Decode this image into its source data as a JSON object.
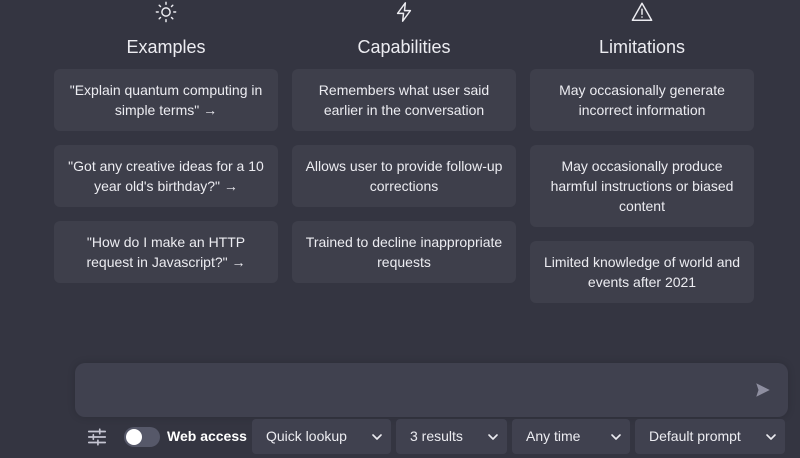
{
  "columns": [
    {
      "icon": "sun-icon",
      "title": "Examples",
      "cards": [
        "\"Explain quantum computing in simple terms\" →",
        "\"Got any creative ideas for a 10 year old's birthday?\" →",
        "\"How do I make an HTTP request in Javascript?\" →"
      ]
    },
    {
      "icon": "lightning-icon",
      "title": "Capabilities",
      "cards": [
        "Remembers what user said earlier in the conversation",
        "Allows user to provide follow-up corrections",
        "Trained to decline inappropriate requests"
      ]
    },
    {
      "icon": "warning-icon",
      "title": "Limitations",
      "cards": [
        "May occasionally generate incorrect information",
        "May occasionally produce harmful instructions or biased content",
        "Limited knowledge of world and events after 2021"
      ]
    }
  ],
  "input": {
    "value": "",
    "placeholder": ""
  },
  "toolbar": {
    "settings_icon": "sliders-icon",
    "web_access_label": "Web access",
    "web_access_enabled": false,
    "mode": "Quick lookup",
    "results": "3 results",
    "time": "Any time",
    "prompt": "Default prompt"
  },
  "colors": {
    "background": "#343541",
    "card": "#3e3f4b",
    "input": "#40414f",
    "text": "#ececf1"
  }
}
